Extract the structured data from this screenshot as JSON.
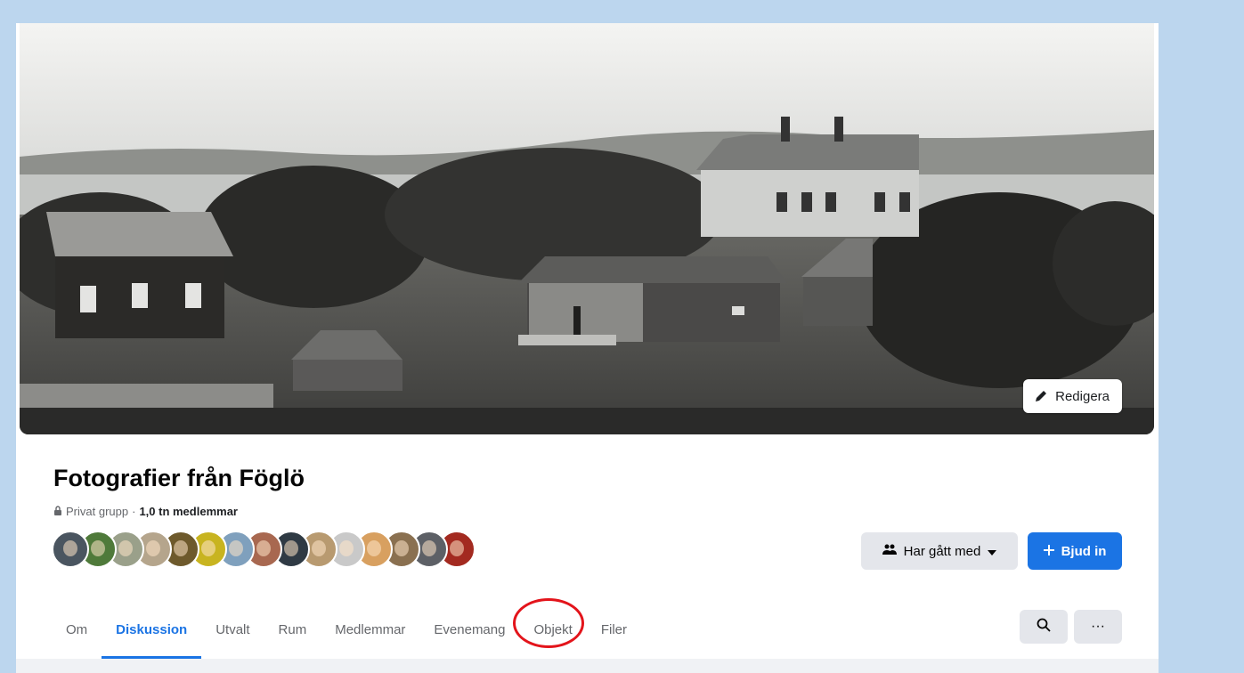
{
  "header": {
    "edit_cover_label": "Redigera",
    "group_name": "Fotografier från Föglö",
    "privacy": "Privat grupp",
    "separator": "·",
    "member_count": "1,0 tn medlemmar"
  },
  "actions": {
    "joined_label": "Har gått med",
    "invite_label": "Bjud in"
  },
  "tabs": [
    {
      "label": "Om"
    },
    {
      "label": "Diskussion"
    },
    {
      "label": "Utvalt"
    },
    {
      "label": "Rum"
    },
    {
      "label": "Medlemmar"
    },
    {
      "label": "Evenemang"
    },
    {
      "label": "Objekt"
    },
    {
      "label": "Filer"
    }
  ],
  "toolbar": {
    "search_icon": "search-icon",
    "more_label": "···"
  },
  "colors": {
    "accent": "#1b74e4",
    "highlight_circle": "#e3141b",
    "page_background": "#bcd6ee"
  },
  "member_avatars": [
    {
      "icon": "avatar",
      "color": "#4a5560"
    },
    {
      "icon": "avatar",
      "color": "#4f7a3a"
    },
    {
      "icon": "avatar",
      "color": "#9aa08a"
    },
    {
      "icon": "avatar",
      "color": "#b5a58c"
    },
    {
      "icon": "avatar",
      "color": "#6e5a2c"
    },
    {
      "icon": "avatar",
      "color": "#c8b420"
    },
    {
      "icon": "avatar",
      "color": "#7fa0bd"
    },
    {
      "icon": "avatar",
      "color": "#a86850"
    },
    {
      "icon": "avatar",
      "color": "#2f3a44"
    },
    {
      "icon": "avatar",
      "color": "#b89a70"
    },
    {
      "icon": "avatar",
      "color": "#c9c9c9"
    },
    {
      "icon": "avatar",
      "color": "#d8a060"
    },
    {
      "icon": "avatar",
      "color": "#8a7050"
    },
    {
      "icon": "avatar",
      "color": "#5d6066"
    },
    {
      "icon": "avatar",
      "color": "#a32a20"
    }
  ]
}
